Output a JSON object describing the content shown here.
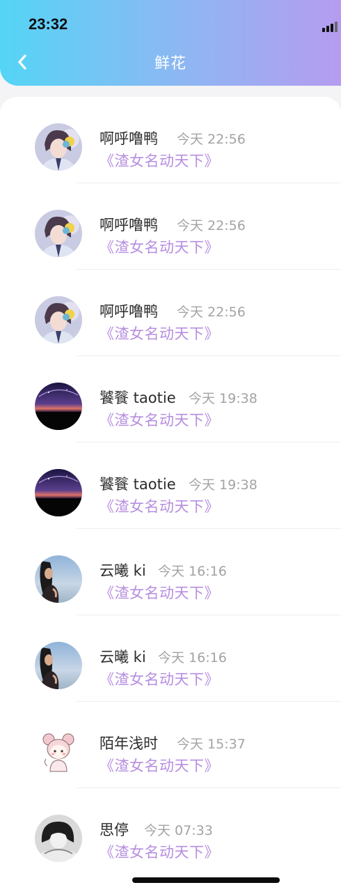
{
  "status": {
    "time": "23:32"
  },
  "header": {
    "title": "鲜花",
    "back_icon": "chevron-left-icon"
  },
  "rows": [
    {
      "name": "啊呼噜鸭",
      "time": "今天 22:56",
      "book": "《渣女名动天下》",
      "avatar": "anime-boy-avatar"
    },
    {
      "name": "啊呼噜鸭",
      "time": "今天 22:56",
      "book": "《渣女名动天下》",
      "avatar": "anime-boy-avatar"
    },
    {
      "name": "啊呼噜鸭",
      "time": "今天 22:56",
      "book": "《渣女名动天下》",
      "avatar": "anime-boy-avatar"
    },
    {
      "name": "饕餮 taotie",
      "time": "今天 19:38",
      "book": "《渣女名动天下》",
      "avatar": "night-sky-avatar"
    },
    {
      "name": "饕餮 taotie",
      "time": "今天 19:38",
      "book": "《渣女名动天下》",
      "avatar": "night-sky-avatar"
    },
    {
      "name": "云曦 ki",
      "time": "今天 16:16",
      "book": "《渣女名动天下》",
      "avatar": "girl-seaside-avatar"
    },
    {
      "name": "云曦 ki",
      "time": "今天 16:16",
      "book": "《渣女名动天下》",
      "avatar": "girl-seaside-avatar"
    },
    {
      "name": "陌年浅时",
      "time": "今天 15:37",
      "book": "《渣女名动天下》",
      "avatar": "cartoon-girl-avatar"
    },
    {
      "name": "思停",
      "time": "今天 07:33",
      "book": "《渣女名动天下》",
      "avatar": "monochrome-girl-avatar"
    }
  ],
  "colors": {
    "header_start": "#54d5f6",
    "header_end": "#b59cf0",
    "book_title": "#b68ee0",
    "time": "#a3a3a3"
  }
}
